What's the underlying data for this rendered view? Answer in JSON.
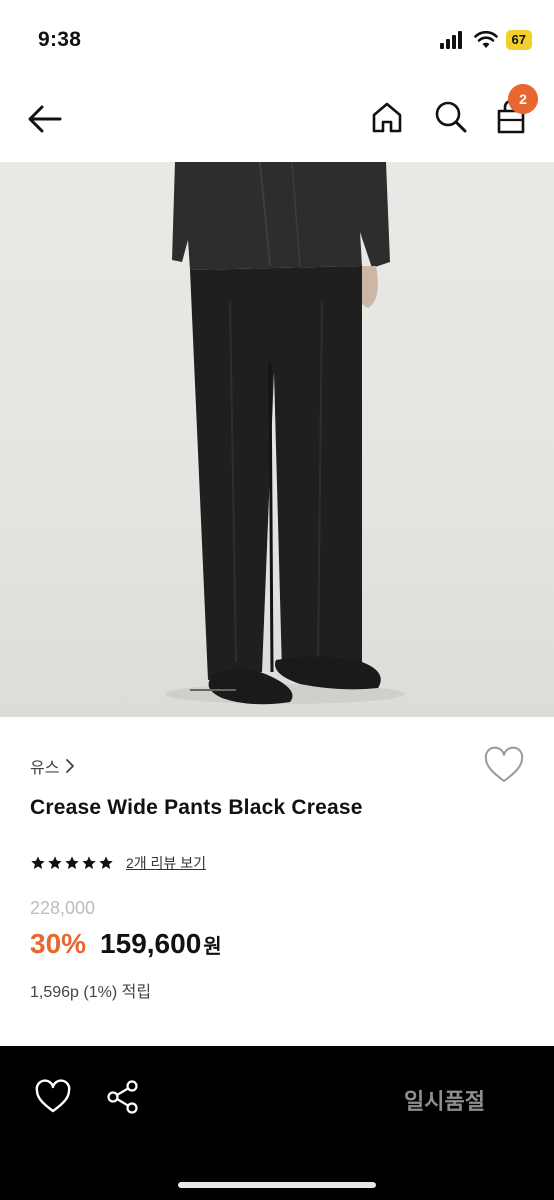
{
  "status_bar": {
    "time": "9:38",
    "battery": "67",
    "icons": [
      "cellular-signal-icon",
      "wifi-icon",
      "battery-icon"
    ]
  },
  "header": {
    "icons": [
      "back-arrow-icon",
      "home-icon",
      "search-icon",
      "shopping-bag-icon"
    ],
    "cart_count": "2",
    "accent_color": "#e8662f"
  },
  "product": {
    "brand": "유스",
    "title": "Crease Wide Pants Black Crease",
    "rating_stars": 5,
    "review_link": "2개 리뷰 보기",
    "original_price": "228,000",
    "discount": "30%",
    "price": "159,600",
    "currency": "원",
    "points": "1,596p (1%) 적립",
    "discount_color": "#e8662f"
  },
  "bottom_bar": {
    "icons": [
      "heart-icon",
      "share-icon"
    ],
    "status_label": "일시품절",
    "background": "#000000"
  }
}
